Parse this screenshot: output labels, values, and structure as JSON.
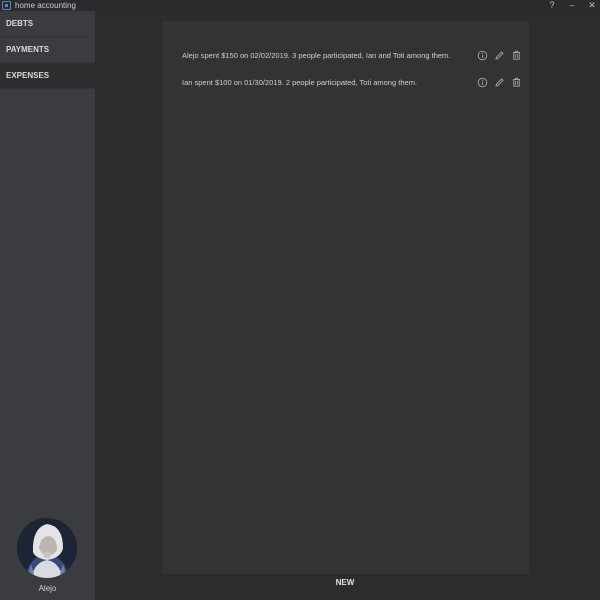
{
  "window": {
    "title": "home accounting",
    "help_label": "?",
    "minimize_label": "–",
    "close_label": "✕"
  },
  "sidebar": {
    "items": [
      {
        "label": "DEBTS",
        "active": false
      },
      {
        "label": "PAYMENTS",
        "active": false
      },
      {
        "label": "EXPENSES",
        "active": true
      }
    ],
    "user": {
      "name": "Alejo"
    }
  },
  "expenses": [
    {
      "text": "Alejo spent $150 on 02/02/2019. 3 people participated, Ian and Toti among them."
    },
    {
      "text": "Ian spent $100 on 01/30/2019. 2 people participated, Toti among them."
    }
  ],
  "actions": {
    "new_label": "NEW"
  },
  "colors": {
    "accent": "#5a86b8",
    "sidebar_bg": "#3b3c3f",
    "panel_bg": "#323335"
  }
}
